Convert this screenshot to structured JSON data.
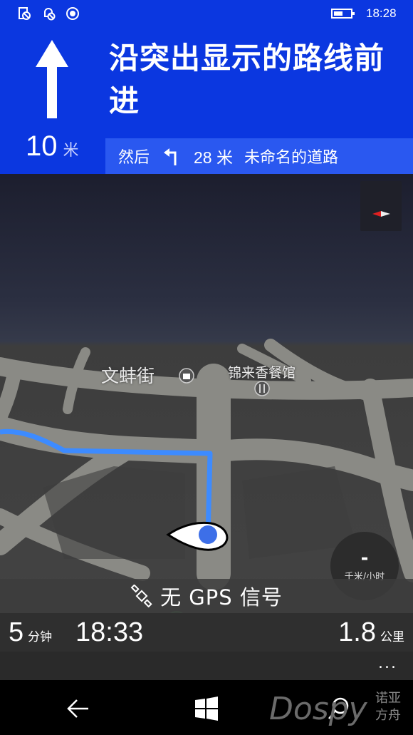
{
  "status": {
    "time": "18:28",
    "battery_level": 0.55,
    "icons": [
      "document-sync-icon",
      "alarm-off-icon",
      "record-icon"
    ]
  },
  "instruction": {
    "main": "沿突出显示的路线前进",
    "distance_value": "10",
    "distance_unit": "米",
    "then_label": "然后",
    "then_distance": "28 米",
    "then_road": "未命名的道路",
    "current_direction_icon": "arrow-up-icon",
    "then_direction_icon": "turn-left-icon"
  },
  "map": {
    "labels": [
      "文蚌街",
      "锦来香餐馆"
    ],
    "poi_icons": [
      "shopping-bag-icon",
      "restaurant-icon"
    ],
    "route_color": "#3d8bff"
  },
  "speed": {
    "value": "-",
    "unit": "千米/小时"
  },
  "gps": {
    "text": "无 GPS 信号"
  },
  "trip": {
    "eta_minutes": "5",
    "eta_minutes_unit": "分钟",
    "arrival_time": "18:33",
    "remaining_distance": "1.8",
    "remaining_unit": "公里",
    "more": "..."
  },
  "navbar": {
    "watermark": "Dospy",
    "watermark_sub_1": "诺亚",
    "watermark_sub_2": "方舟"
  },
  "colors": {
    "header_blue": "#0b37e0",
    "then_bar_blue": "#2a58f0"
  }
}
